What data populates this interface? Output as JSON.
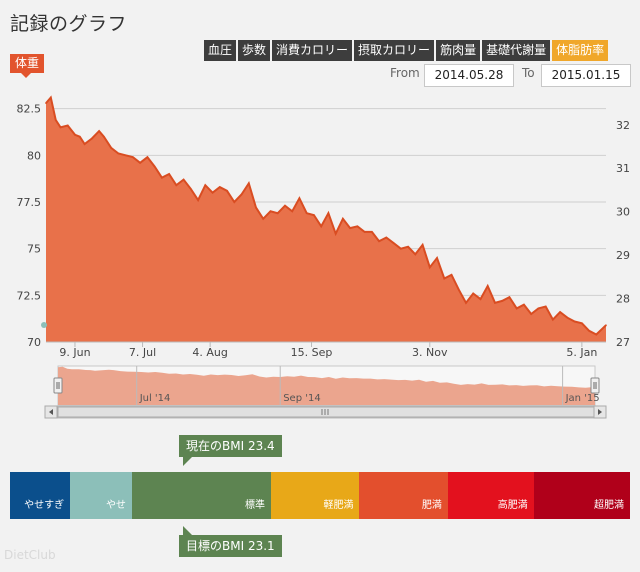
{
  "page": {
    "title": "記録のグラフ"
  },
  "tabs": [
    {
      "label": "血圧",
      "active": false
    },
    {
      "label": "歩数",
      "active": false
    },
    {
      "label": "消費カロリー",
      "active": false
    },
    {
      "label": "摂取カロリー",
      "active": false
    },
    {
      "label": "筋肉量",
      "active": false
    },
    {
      "label": "基礎代謝量",
      "active": false
    },
    {
      "label": "体脂肪率",
      "active": true
    }
  ],
  "range": {
    "from_label": "From",
    "from_value": "2014.05.28",
    "to_label": "To",
    "to_value": "2015.01.15"
  },
  "series_badge": "体重",
  "colors": {
    "area": "#e8714a",
    "line": "#d94d22",
    "navigator_area": "#eba58e",
    "bmi_callout": "#5d8451"
  },
  "chart_data": {
    "type": "area",
    "title": "",
    "xlabel": "",
    "ylabel": "体重",
    "ylim": [
      70,
      83.5
    ],
    "yticks": [
      70,
      72.5,
      75,
      77.5,
      80,
      82.5
    ],
    "ytick_labels": [
      "70",
      "72.5",
      "75",
      "77.5",
      "80",
      "82.5"
    ],
    "y2lim": [
      27,
      32.8
    ],
    "y2ticks": [
      27,
      28,
      29,
      30,
      31,
      32
    ],
    "y2tick_labels": [
      "27",
      "28",
      "29",
      "30",
      "31",
      "32"
    ],
    "xlim": [
      "2014-05-28",
      "2015-01-15"
    ],
    "xtick_labels": [
      "9. Jun",
      "7. Jul",
      "4. Aug",
      "15. Sep",
      "3. Nov",
      "5. Jan"
    ],
    "xtick_dates": [
      "2014-06-09",
      "2014-07-07",
      "2014-08-04",
      "2014-09-15",
      "2014-11-03",
      "2015-01-05"
    ],
    "grid": true,
    "series": [
      {
        "name": "体重",
        "x": [
          "2014-05-28",
          "2014-05-30",
          "2014-06-01",
          "2014-06-03",
          "2014-06-06",
          "2014-06-09",
          "2014-06-11",
          "2014-06-13",
          "2014-06-16",
          "2014-06-19",
          "2014-06-21",
          "2014-06-24",
          "2014-06-27",
          "2014-06-30",
          "2014-07-03",
          "2014-07-06",
          "2014-07-09",
          "2014-07-12",
          "2014-07-15",
          "2014-07-18",
          "2014-07-21",
          "2014-07-24",
          "2014-07-27",
          "2014-07-30",
          "2014-08-02",
          "2014-08-05",
          "2014-08-08",
          "2014-08-11",
          "2014-08-14",
          "2014-08-17",
          "2014-08-20",
          "2014-08-23",
          "2014-08-26",
          "2014-08-29",
          "2014-09-01",
          "2014-09-04",
          "2014-09-07",
          "2014-09-10",
          "2014-09-13",
          "2014-09-16",
          "2014-09-19",
          "2014-09-22",
          "2014-09-25",
          "2014-09-28",
          "2014-10-01",
          "2014-10-04",
          "2014-10-07",
          "2014-10-10",
          "2014-10-13",
          "2014-10-16",
          "2014-10-19",
          "2014-10-22",
          "2014-10-25",
          "2014-10-28",
          "2014-10-31",
          "2014-11-03",
          "2014-11-06",
          "2014-11-09",
          "2014-11-12",
          "2014-11-15",
          "2014-11-18",
          "2014-11-21",
          "2014-11-24",
          "2014-11-27",
          "2014-11-30",
          "2014-12-03",
          "2014-12-06",
          "2014-12-09",
          "2014-12-12",
          "2014-12-15",
          "2014-12-18",
          "2014-12-21",
          "2014-12-24",
          "2014-12-27",
          "2014-12-30",
          "2015-01-02",
          "2015-01-05",
          "2015-01-08",
          "2015-01-11",
          "2015-01-15"
        ],
        "values": [
          82.8,
          83.1,
          81.9,
          81.5,
          81.6,
          81.1,
          81.0,
          80.6,
          80.9,
          81.3,
          81.0,
          80.4,
          80.1,
          80.0,
          79.9,
          79.6,
          79.9,
          79.4,
          78.8,
          79.0,
          78.4,
          78.7,
          78.2,
          77.6,
          78.4,
          78.0,
          78.3,
          78.1,
          77.5,
          77.9,
          78.5,
          77.2,
          76.6,
          77.0,
          76.9,
          77.3,
          77.0,
          77.7,
          76.9,
          76.8,
          76.2,
          76.9,
          75.8,
          76.6,
          76.1,
          76.2,
          75.9,
          75.9,
          75.4,
          75.6,
          75.3,
          75.0,
          75.1,
          74.7,
          75.2,
          74.0,
          74.5,
          73.4,
          73.6,
          72.8,
          72.1,
          72.6,
          72.3,
          73.0,
          72.1,
          72.2,
          72.4,
          71.8,
          72.0,
          71.5,
          71.8,
          71.9,
          71.2,
          71.6,
          71.3,
          71.1,
          71.0,
          70.6,
          70.4,
          70.9
        ]
      }
    ],
    "navigator": {
      "tick_labels": [
        "Jul '14",
        "Sep '14",
        "Jan '15"
      ],
      "tick_dates": [
        "2014-07-01",
        "2014-09-01",
        "2015-01-01"
      ]
    }
  },
  "bmi": {
    "segments": [
      {
        "label": "やせすぎ",
        "color": "#0b4f8c",
        "weight": 70
      },
      {
        "label": "やせ",
        "color": "#8cbfb9",
        "weight": 72
      },
      {
        "label": "標準",
        "color": "#5d8451",
        "weight": 162
      },
      {
        "label": "軽肥満",
        "color": "#e8a818",
        "weight": 103
      },
      {
        "label": "肥満",
        "color": "#e34f2d",
        "weight": 103
      },
      {
        "label": "高肥満",
        "color": "#e3111e",
        "weight": 100
      },
      {
        "label": "超肥満",
        "color": "#b0001a",
        "weight": 112
      }
    ],
    "current_label": "現在のBMI 23.4",
    "target_label": "目標のBMI 23.1"
  },
  "watermark": "DietClub"
}
